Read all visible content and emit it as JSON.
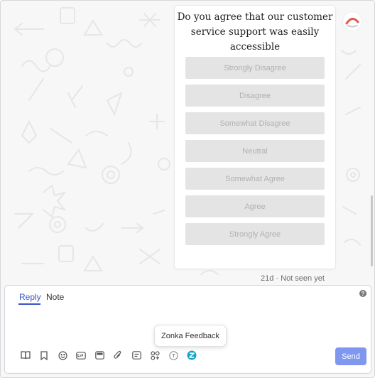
{
  "survey": {
    "question": "Do you agree that our customer\nservice support  was easily accessible\nand effective?",
    "options": [
      "Strongly Disagree",
      "Disagree",
      "Somewhat Disagree",
      "Neutral",
      "Somewhat Agree",
      "Agree",
      "Strongly Agree"
    ]
  },
  "message_meta": "21d · Not seen yet",
  "composer": {
    "tabs": [
      "Reply",
      "Note"
    ],
    "active_tab": "Reply",
    "send_label": "Send",
    "tooltip": "Zonka Feedback",
    "help_icon": "?",
    "toolbar_icons": [
      "book-icon",
      "bookmark-icon",
      "emoji-icon",
      "gif-icon",
      "image-icon",
      "attachment-icon",
      "article-icon",
      "apps-icon",
      "text-format-icon",
      "zonka-feedback-icon"
    ]
  },
  "colors": {
    "accent": "#3a53c8",
    "send_button": "#7f97ef",
    "option_bg": "#e4e4e4",
    "option_text": "#b1b1b1",
    "zonka_brand": "#1aa6c8"
  }
}
